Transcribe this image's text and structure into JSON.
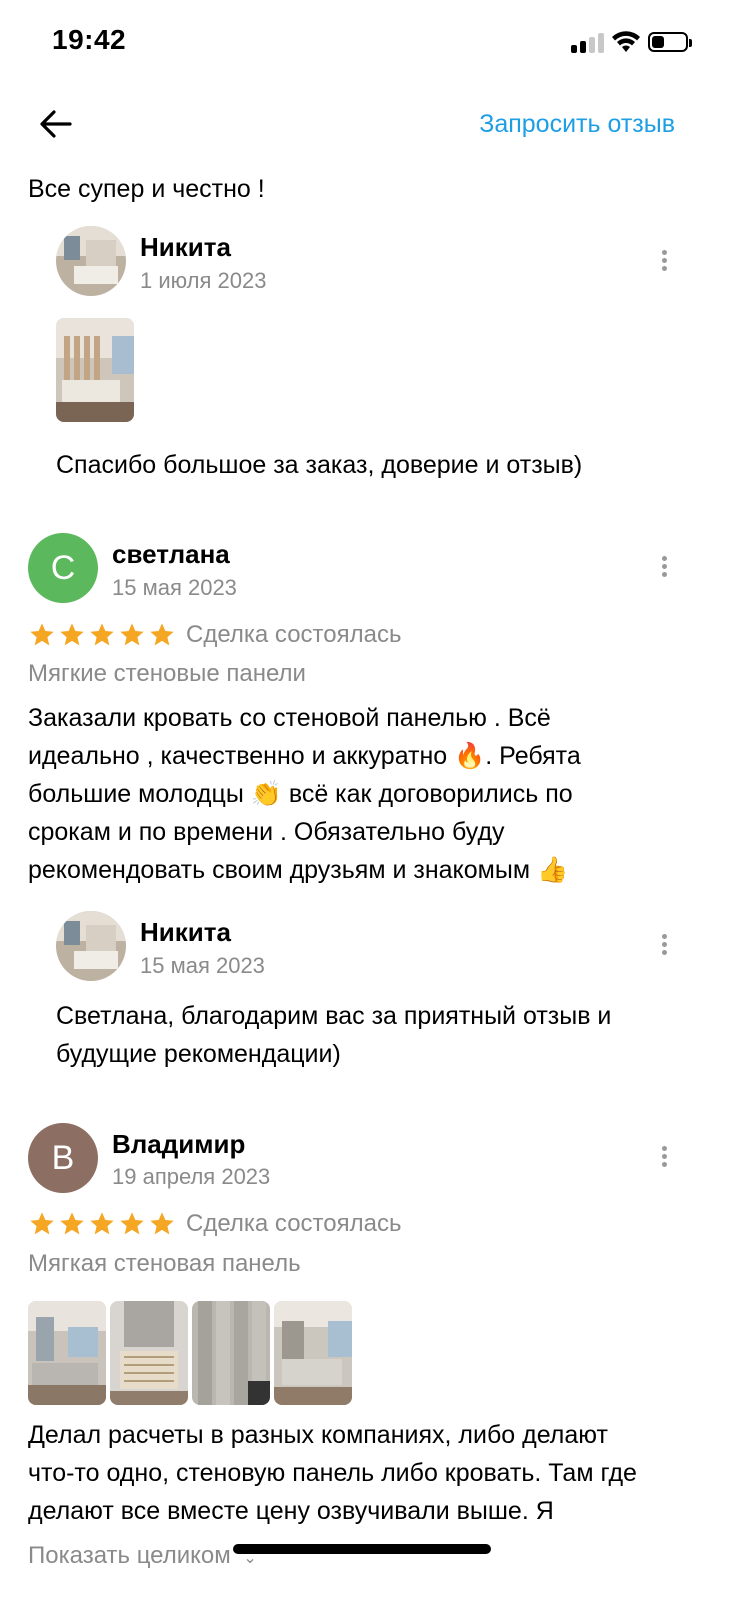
{
  "status_bar": {
    "time": "19:42"
  },
  "header": {
    "request_review": "Запросить отзыв"
  },
  "reviews": [
    {
      "text": "Все супер и честно !",
      "reply": {
        "author": "Никита",
        "date": "1 июля 2023",
        "text": "Спасибо большое за заказ, доверие и отзыв)"
      }
    },
    {
      "author": "светлана",
      "avatar_letter": "С",
      "avatar_color": "#5cb85c",
      "date": "15 мая 2023",
      "rating": 5,
      "deal_status": "Сделка состоялась",
      "product": "Мягкие стеновые панели",
      "text_lines": [
        "Заказали кровать со стеновой панелью . Всё",
        "идеально , качественно и аккуратно 🔥. Ребята",
        "большие молодцы 👏 всё как договорились по",
        "срокам и по времени . Обязательно буду",
        "рекомендовать своим друзьям и знакомым 👍"
      ],
      "reply": {
        "author": "Никита",
        "date": "15 мая 2023",
        "text_lines": [
          "Светлана, благодарим вас за приятный отзыв и",
          "будущие рекомендации)"
        ]
      }
    },
    {
      "author": "Владимир",
      "avatar_letter": "В",
      "avatar_color": "#8d6e63",
      "date": "19 апреля 2023",
      "rating": 5,
      "deal_status": "Сделка состоялась",
      "product": "Мягкая стеновая панель",
      "text_lines": [
        "Делал расчеты в разных компаниях, либо делают",
        "что-то одно, стеновую панель либо кровать. Там где",
        "делают все вместе цену озвучивали выше. Я"
      ],
      "show_more": "Показать целиком"
    }
  ],
  "colors": {
    "accent": "#1e9fe5",
    "star": "#f5a623"
  }
}
